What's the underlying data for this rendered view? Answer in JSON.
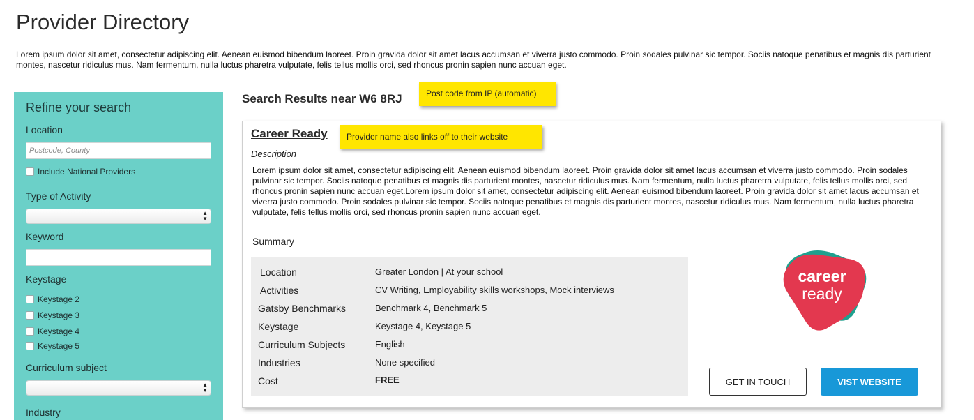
{
  "page": {
    "title": "Provider Directory",
    "intro": "Lorem ipsum dolor sit amet, consectetur adipiscing elit. Aenean euismod bibendum laoreet. Proin gravida dolor sit amet lacus accumsan et viverra justo commodo. Proin sodales pulvinar sic tempor. Sociis natoque penatibus et magnis dis parturient montes, nascetur ridiculus mus. Nam fermentum, nulla luctus pharetra vulputate, felis tellus mollis orci, sed rhoncus pronin sapien nunc accuan eget."
  },
  "sidebar": {
    "heading": "Refine your search",
    "location_label": "Location",
    "location_placeholder": "Postcode, County",
    "location_value": "",
    "include_national_label": "Include National Providers",
    "include_national_checked": false,
    "activity_label": "Type of Activity",
    "activity_value": "",
    "keyword_label": "Keyword",
    "keyword_value": "",
    "keystage_label": "Keystage",
    "keystages": [
      {
        "label": "Keystage 2",
        "checked": false
      },
      {
        "label": "Keystage 3",
        "checked": false
      },
      {
        "label": "Keystage 4",
        "checked": false
      },
      {
        "label": "Keystage 5",
        "checked": false
      }
    ],
    "curriculum_label": "Curriculum subject",
    "curriculum_value": "",
    "industry_label": "Industry"
  },
  "results": {
    "title": "Search Results near W6 8RJ",
    "postcode_note": "Post code from IP (automatic)",
    "provider_note": "Provider name also links off to their website"
  },
  "provider": {
    "name": "Career Ready",
    "description_label": "Description",
    "description": "Lorem ipsum dolor sit amet, consectetur adipiscing elit. Aenean euismod bibendum laoreet. Proin gravida dolor sit amet lacus accumsan et viverra justo commodo. Proin sodales pulvinar sic tempor. Sociis natoque penatibus et magnis dis parturient montes, nascetur ridiculus mus. Nam fermentum, nulla luctus pharetra vulputate, felis tellus mollis orci, sed rhoncus pronin sapien nunc accuan eget.Lorem ipsum dolor sit amet, consectetur adipiscing elit. Aenean euismod bibendum laoreet. Proin gravida dolor sit amet lacus accumsan et viverra justo commodo. Proin sodales pulvinar sic tempor. Sociis natoque penatibus et magnis dis parturient montes, nascetur ridiculus mus. Nam fermentum, nulla luctus pharetra vulputate, felis tellus mollis orci, sed rhoncus pronin sapien nunc accuan eget.",
    "summary_label": "Summary",
    "summary": [
      {
        "key": "Location",
        "value": "Greater London | At your school"
      },
      {
        "key": "Activities",
        "value": "CV Writing, Employability skills workshops, Mock interviews"
      },
      {
        "key": "Gatsby Benchmarks",
        "value": "Benchmark 4, Benchmark 5"
      },
      {
        "key": "Keystage",
        "value": "Keystage 4, Keystage 5"
      },
      {
        "key": "Curriculum Subjects",
        "value": "English"
      },
      {
        "key": "Industries",
        "value": "None specified"
      },
      {
        "key": "Cost",
        "value": "FREE"
      }
    ],
    "logo_text_line1": "career",
    "logo_text_line2": "ready",
    "contact_button": "GET IN TOUCH",
    "website_button": "VIST WEBSITE"
  },
  "colors": {
    "sidebar_bg": "#6bd0c8",
    "note_bg": "#ffe600",
    "primary_button": "#1898d8",
    "logo_red": "#e3384f",
    "logo_teal": "#1fa08e"
  }
}
